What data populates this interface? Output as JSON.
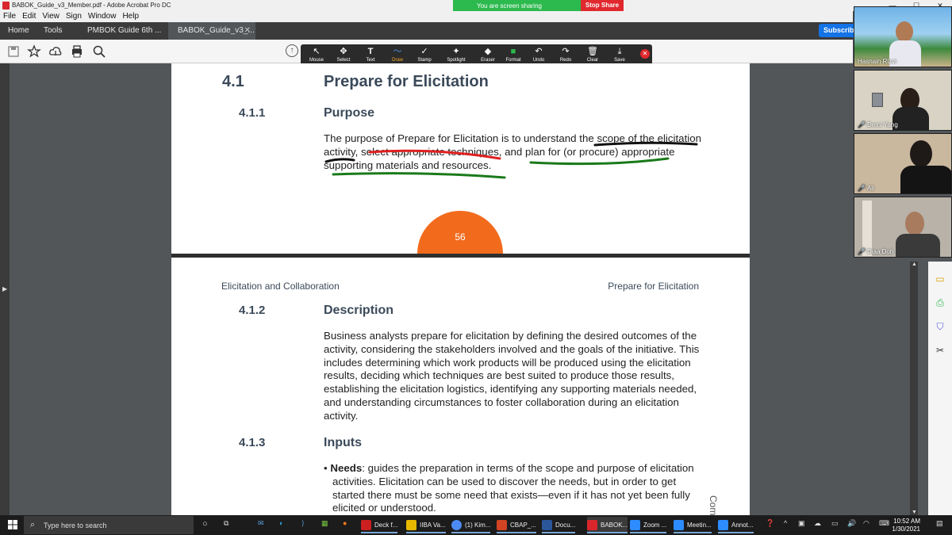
{
  "window": {
    "title": "BABOK_Guide_v3_Member.pdf - Adobe Acrobat Pro DC",
    "min": "—",
    "max": "☐",
    "close": "✕"
  },
  "share_banner": {
    "label": "You are screen sharing",
    "stop": "Stop Share"
  },
  "menu": [
    "File",
    "Edit",
    "View",
    "Sign",
    "Window",
    "Help"
  ],
  "tabs": {
    "home": "Home",
    "tools": "Tools",
    "doc1": "PMBOK Guide 6th ...",
    "doc2": "BABOK_Guide_v3_...",
    "close": "✕"
  },
  "subscribe": "Subscrib",
  "annotation_tools": [
    {
      "label": "Mouse",
      "glyph": "↖"
    },
    {
      "label": "Select",
      "glyph": "✥"
    },
    {
      "label": "Text",
      "glyph": "T"
    },
    {
      "label": "Draw",
      "glyph": "〜"
    },
    {
      "label": "Stamp",
      "glyph": "✓"
    },
    {
      "label": "Spotlight",
      "glyph": "✦"
    },
    {
      "label": "Eraser",
      "glyph": "◆"
    },
    {
      "label": "Format",
      "glyph": "■"
    },
    {
      "label": "Undo",
      "glyph": "↶"
    },
    {
      "label": "Redo",
      "glyph": "↷"
    },
    {
      "label": "Clear",
      "glyph": "🗑"
    },
    {
      "label": "Save",
      "glyph": "⤓"
    }
  ],
  "page1": {
    "section_num": "4.1",
    "section_title": "Prepare for Elicitation",
    "sub_num": "4.1.1",
    "sub_title": "Purpose",
    "purpose_lines": [
      "The purpose of Prepare for Elicitation is to understand the scope of the elicitation",
      "activity, select appropriate techniques, and plan for (or procure) appropriate",
      "supporting materials and resources."
    ],
    "page_number": "56"
  },
  "page2": {
    "running_left": "Elicitation and Collaboration",
    "running_right": "Prepare for Elicitation",
    "desc_num": "4.1.2",
    "desc_title": "Description",
    "desc_lines": [
      "Business analysts prepare for elicitation by defining the desired outcomes of the",
      "activity, considering the stakeholders involved and the goals of the initiative. This",
      "includes determining which work products will be produced using the elicitation",
      "results, deciding which techniques are best suited to produce those results,",
      "establishing the elicitation logistics, identifying any supporting materials needed,",
      "and understanding circumstances to foster collaboration during an elicitation",
      "activity."
    ],
    "inputs_num": "4.1.3",
    "inputs_title": "Inputs",
    "bullet_term": "Needs",
    "bullet_lines": [
      ": guides the preparation in terms of the scope and purpose of elicitation",
      "activities. Elicitation can be used to discover the needs, but in order to get",
      "started there must be some need that exists—even if it has not yet been fully",
      "elicited or understood."
    ],
    "vertical_text": "Com"
  },
  "participants": [
    {
      "name": "Hasnain Rizvi"
    },
    {
      "name": "Demi Yang"
    },
    {
      "name": "Ali"
    },
    {
      "name": "Diaa Doh"
    }
  ],
  "taskbar": {
    "search_placeholder": "Type here to search",
    "items": [
      {
        "label": "Deck f...",
        "color": "#cc1f1f"
      },
      {
        "label": "IIBA Va...",
        "color": "#e6b800"
      },
      {
        "label": "(1) Kim...",
        "color": "#4c8bf5"
      },
      {
        "label": "CBAP_...",
        "color": "#d04423"
      },
      {
        "label": "Docu...",
        "color": "#2b579a"
      },
      {
        "label": "BABOK...",
        "color": "#d9262c"
      },
      {
        "label": "Zoom ...",
        "color": "#2d8cff"
      },
      {
        "label": "Meetin...",
        "color": "#2d8cff"
      },
      {
        "label": "Annot...",
        "color": "#2d8cff"
      }
    ],
    "time": "10:52 AM",
    "date": "1/30/2021"
  }
}
